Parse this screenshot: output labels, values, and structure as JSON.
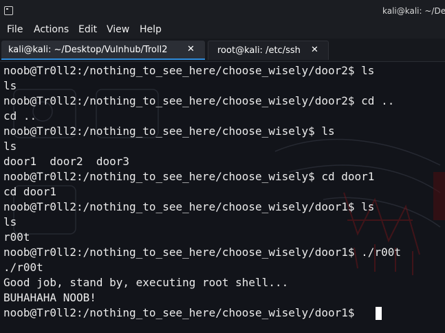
{
  "window": {
    "title": "kali@kali: ~/Desk",
    "icon": "terminal-icon"
  },
  "menu": [
    "File",
    "Actions",
    "Edit",
    "View",
    "Help"
  ],
  "tabs": [
    {
      "label": "kali@kali: ~/Desktop/Vulnhub/Troll2",
      "close": "✕",
      "active": true
    },
    {
      "label": "root@kali: /etc/ssh",
      "close": "✕",
      "active": false
    }
  ],
  "terminal": {
    "lines": [
      "noob@Tr0ll2:/nothing_to_see_here/choose_wisely/door2$ ls",
      "ls",
      "noob@Tr0ll2:/nothing_to_see_here/choose_wisely/door2$ cd ..",
      "cd ..",
      "noob@Tr0ll2:/nothing_to_see_here/choose_wisely$ ls",
      "ls",
      "door1  door2  door3",
      "noob@Tr0ll2:/nothing_to_see_here/choose_wisely$ cd door1",
      "cd door1",
      "noob@Tr0ll2:/nothing_to_see_here/choose_wisely/door1$ ls",
      "ls",
      "r00t",
      "noob@Tr0ll2:/nothing_to_see_here/choose_wisely/door1$ ./r00t",
      "./r00t",
      "Good job, stand by, executing root shell...",
      "BUHAHAHA NOOB!",
      "noob@Tr0ll2:/nothing_to_see_here/choose_wisely/door1$ "
    ]
  },
  "colors": {
    "terminal_bg": "#12141a",
    "text": "#ececec",
    "tab_accent": "#2d8bdb",
    "art_red": "#7a1418"
  }
}
